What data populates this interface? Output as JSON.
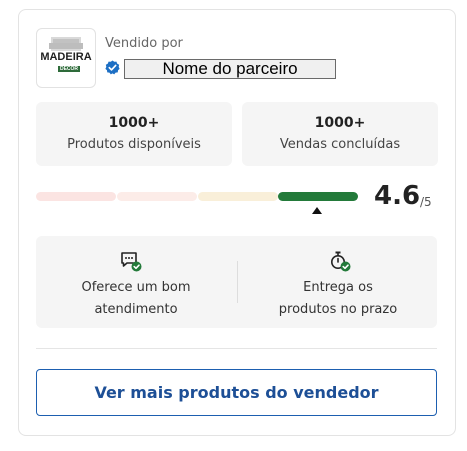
{
  "seller": {
    "logo": {
      "main": "MADEIRA",
      "sub": "DECOR"
    },
    "sold_by_label": "Vendido por",
    "verified_icon": "verified-check-icon",
    "partner_name": "Nome do parceiro"
  },
  "stats": [
    {
      "value": "1000+",
      "label": "Produtos disponíveis"
    },
    {
      "value": "1000+",
      "label": "Vendas concluídas"
    }
  ],
  "rating": {
    "value": "4.6",
    "max": "/5",
    "active_segment": 4,
    "segment_colors": [
      "#fbe4e2",
      "#fcece8",
      "#f9efd9",
      "#237a3a"
    ]
  },
  "features": [
    {
      "icon": "chat-check-icon",
      "line1": "Oferece um bom",
      "line2": "atendimento"
    },
    {
      "icon": "stopwatch-check-icon",
      "line1": "Entrega os",
      "line2": "produtos no prazo"
    }
  ],
  "colors": {
    "accent": "#1d5fb0",
    "success": "#237a3a"
  },
  "button": {
    "label": "Ver mais produtos do vendedor"
  }
}
